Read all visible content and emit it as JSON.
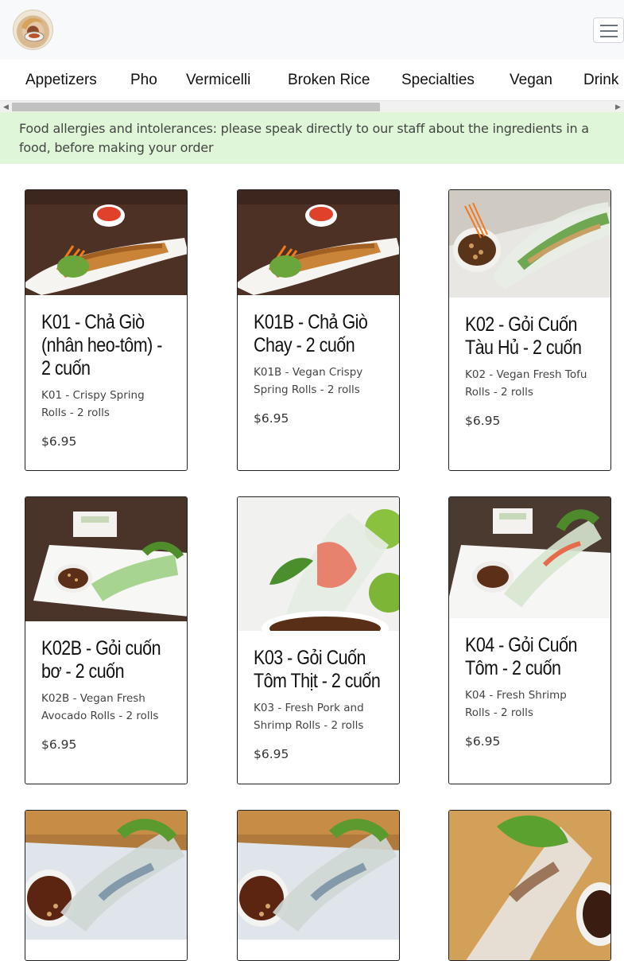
{
  "nav": {
    "items": [
      "Appetizers",
      "Pho",
      "Vermicelli",
      "Broken Rice",
      "Specialties",
      "Vegan",
      "Drink"
    ]
  },
  "notice": "Food allergies and intolerances: please speak directly to our staff about the ingredients in a food, before making your order",
  "menu_items": [
    {
      "title": "K01 - Chả Giò (nhân heo-tôm) - 2 cuốn",
      "desc": "K01 - Crispy Spring Rolls - 2 rolls",
      "price": "$6.95"
    },
    {
      "title": "K01B - Chả Giò Chay - 2 cuốn",
      "desc": "K01B - Vegan Crispy Spring Rolls - 2 rolls",
      "price": "$6.95"
    },
    {
      "title": "K02 - Gỏi Cuốn Tàu Hủ - 2 cuốn",
      "desc": "K02 - Vegan Fresh Tofu Rolls - 2 rolls",
      "price": "$6.95"
    },
    {
      "title": "K02B - Gỏi cuốn bơ - 2 cuốn",
      "desc": "K02B - Vegan Fresh Avocado Rolls - 2 rolls",
      "price": "$6.95"
    },
    {
      "title": "K03 - Gỏi Cuốn Tôm Thịt - 2 cuốn",
      "desc": "K03 - Fresh Pork and Shrimp Rolls - 2 rolls",
      "price": "$6.95"
    },
    {
      "title": "K04 - Gỏi Cuốn Tôm - 2 cuốn",
      "desc": "K04 - Fresh Shrimp Rolls - 2 rolls",
      "price": "$6.95"
    }
  ],
  "icons": {
    "menu": "hamburger-icon",
    "logo": "restaurant-logo"
  },
  "colors": {
    "notice_bg": "#dff7d8",
    "topbar_bg": "#f8f9fa"
  }
}
